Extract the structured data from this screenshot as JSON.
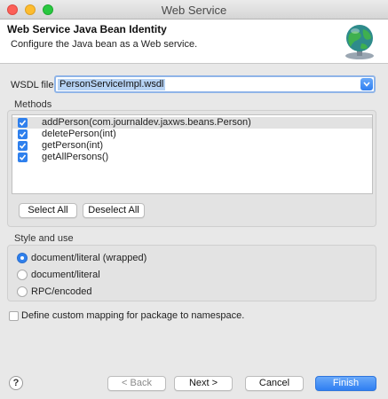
{
  "window": {
    "title": "Web Service"
  },
  "header": {
    "title": "Web Service Java Bean Identity",
    "description": "Configure the Java bean as a Web service.",
    "icon": "web-service-globe-icon"
  },
  "wsdl": {
    "label": "WSDL file:",
    "value": "PersonServiceImpl.wsdl"
  },
  "methods": {
    "label": "Methods",
    "items": [
      {
        "name": "addPerson(com.journaldev.jaxws.beans.Person)",
        "checked": true
      },
      {
        "name": "deletePerson(int)",
        "checked": true
      },
      {
        "name": "getPerson(int)",
        "checked": true
      },
      {
        "name": "getAllPersons()",
        "checked": true
      }
    ],
    "select_all": "Select All",
    "deselect_all": "Deselect All"
  },
  "style": {
    "label": "Style and use",
    "options": [
      {
        "label": "document/literal (wrapped)",
        "selected": true
      },
      {
        "label": "document/literal",
        "selected": false
      },
      {
        "label": "RPC/encoded",
        "selected": false
      }
    ]
  },
  "custom_mapping": {
    "label": "Define custom mapping for package to namespace.",
    "checked": false
  },
  "footer": {
    "help": "?",
    "back": "< Back",
    "next": "Next >",
    "cancel": "Cancel",
    "finish": "Finish"
  },
  "colors": {
    "accent": "#2f80ed",
    "selection": "#b6d2f3"
  }
}
